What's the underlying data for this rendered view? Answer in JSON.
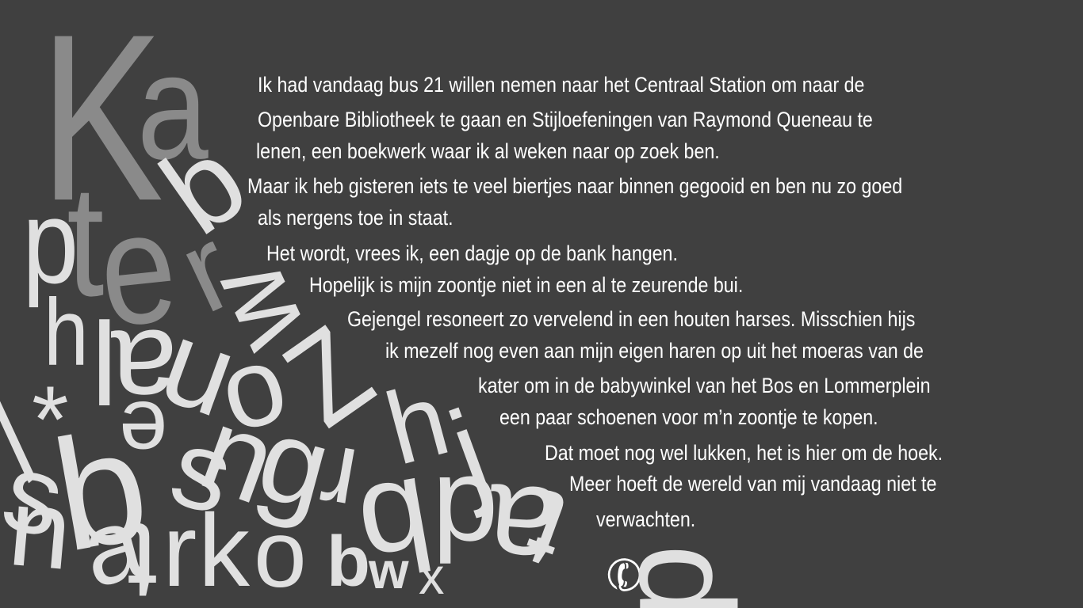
{
  "paragraph_lines": [
    "Ik had vandaag bus 21 willen nemen naar het Centraal Station om naar de",
    "Openbare Bibliotheek te gaan en Stijloefeningen van Raymond Queneau te",
    "lenen, een boekwerk waar ik al weken naar op zoek ben.",
    "Maar ik heb gisteren iets te veel biertjes naar binnen gegooid en ben nu zo goed",
    "als nergens toe in staat.",
    "Het wordt, vrees ik, een dagje op de bank hangen.",
    "Hopelijk is mijn zoontje niet in een al te zeurende bui.",
    "Gejengel resoneert zo vervelend in een houten harses. Misschien hijs",
    "ik mezelf nog even aan mijn eigen haren op uit het moeras van de",
    "kater om in de babywinkel van het Bos en Lommerplein",
    "een paar schoenen voor m’n zoontje te kopen.",
    "Dat moet nog wel lukken, het is hier om de hoek.",
    "Meer hoeft de wereld van mij vandaag niet te",
    "verwachten."
  ],
  "letters": {
    "K": "K",
    "a": "a",
    "b": "b",
    "p_small": "p",
    "p_big": "p",
    "t": "t",
    "e": "e",
    "r": "r",
    "w": "w",
    "h_left": "h",
    "l_a": "l",
    "a_upside": "a",
    "u_rot": "u",
    "o": "o",
    "n": "n",
    "z": "Z",
    "h_mid": "h",
    "j": "j",
    "star": "*",
    "slash": "/",
    "s_left": "s",
    "b2": "b",
    "e2": "e",
    "s2": "s",
    "n2": "n",
    "g": "g",
    "r2": "r",
    "q": "q",
    "d": "d",
    "a_right": "a",
    "t2": "t",
    "u2": "u",
    "a2": "a",
    "t3": "t",
    "r3": "r",
    "k": "k",
    "o2": "o",
    "b3": "b",
    "w2": "w",
    "x": "x",
    "phone": "✆",
    "q2": "d"
  },
  "colors": {
    "background": "#404040",
    "text": "#ffffff",
    "dark_grey": "#8c8c8c",
    "mid_grey": "#a8a8a8",
    "light_grey": "#dcdcdc"
  }
}
